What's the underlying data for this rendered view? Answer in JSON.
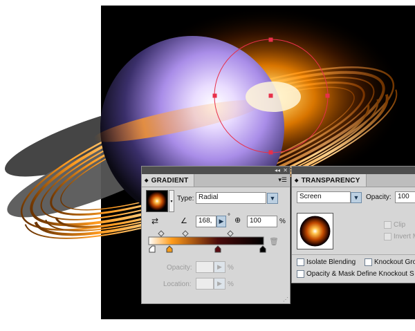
{
  "gradient_panel": {
    "title": "GRADIENT",
    "type_label": "Type:",
    "type_value": "Radial",
    "angle_value": "168,",
    "degree_symbol": "°",
    "aspect_value": "100",
    "aspect_unit": "%",
    "opacity_label": "Opacity:",
    "opacity_unit": "%",
    "location_label": "Location:",
    "location_unit": "%"
  },
  "transparency_panel": {
    "title": "TRANSPARENCY",
    "blend_mode": "Screen",
    "opacity_label": "Opacity:",
    "opacity_value": "100",
    "clip_label": "Clip",
    "invert_label": "Invert M",
    "isolate_label": "Isolate Blending",
    "knockout_label": "Knockout Gro",
    "opacity_mask_label": "Opacity & Mask Define Knockout S"
  },
  "colors": {
    "canvas": "#000000",
    "panel": "#d6d6d6",
    "selection": "#e8304a"
  },
  "icons": [
    "collapse-icon",
    "panel-menu-icon",
    "reverse-gradient-icon",
    "angle-icon",
    "aspect-ratio-icon",
    "trash-icon",
    "resize-grip-icon"
  ]
}
